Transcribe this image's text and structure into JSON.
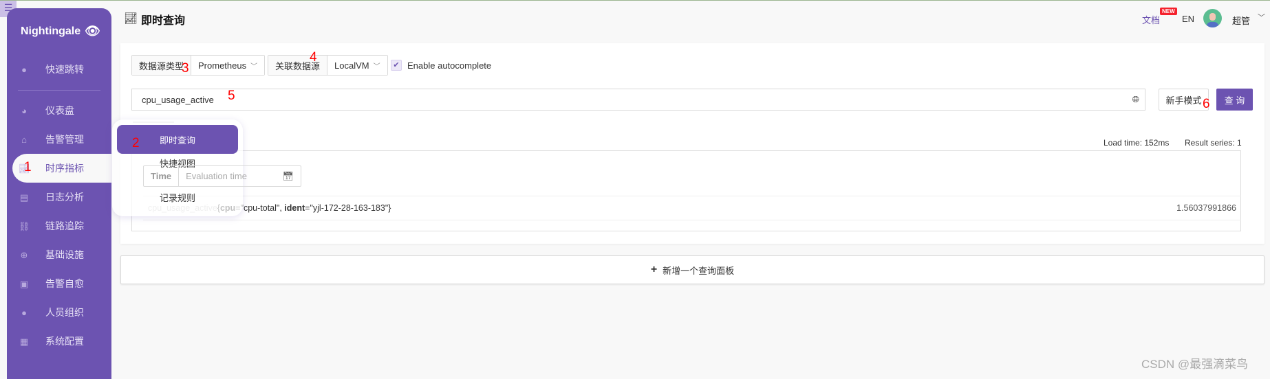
{
  "app": {
    "logo_text": "Nightingale",
    "menu_toggle_icon": "menu-fold-icon",
    "accent_color": "#6c53b1"
  },
  "sidebar": {
    "items": [
      {
        "label": "快速跳转",
        "icon": "search-icon"
      },
      {
        "label": "仪表盘",
        "icon": "dashboard-icon"
      },
      {
        "label": "告警管理",
        "icon": "alarm-icon"
      },
      {
        "label": "时序指标",
        "icon": "line-chart-icon",
        "active": true
      },
      {
        "label": "日志分析",
        "icon": "log-icon"
      },
      {
        "label": "链路追踪",
        "icon": "link-icon"
      },
      {
        "label": "基础设施",
        "icon": "target-icon"
      },
      {
        "label": "告警自愈",
        "icon": "terminal-icon"
      },
      {
        "label": "人员组织",
        "icon": "user-icon"
      },
      {
        "label": "系统配置",
        "icon": "grid-icon"
      }
    ]
  },
  "submenu": {
    "items": [
      {
        "label": "即时查询",
        "active": true
      },
      {
        "label": "快捷视图"
      },
      {
        "label": "记录规则"
      }
    ]
  },
  "header": {
    "title": "即时查询",
    "docs": "文档",
    "new_badge": "NEW",
    "lang": "EN",
    "user": "超管"
  },
  "query": {
    "datasource_type_label": "数据源类型",
    "datasource_type": "Prometheus",
    "datasource_label": "关联数据源",
    "datasource": "LocalVM",
    "autocomplete_label": "Enable autocomplete",
    "autocomplete_checked": true,
    "expression": "cpu_usage_active",
    "guide_button": "新手模式",
    "query_button": "查 询"
  },
  "result": {
    "load_time": "Load time: 152ms",
    "result_series": "Result series: 1",
    "time_label": "Time",
    "time_placeholder": "Evaluation time",
    "rows": [
      {
        "metric": "cpu_usage_active",
        "labels": [
          {
            "k": "cpu",
            "v": "\"cpu-total\""
          },
          {
            "k": "ident",
            "v": "\"yjl-172-28-163-183\""
          }
        ],
        "value": "1.56037991866"
      }
    ]
  },
  "add_panel": "新增一个查询面板",
  "annotations": [
    "1",
    "2",
    "3",
    "4",
    "5",
    "6"
  ],
  "watermark": "CSDN @最强滴菜鸟"
}
